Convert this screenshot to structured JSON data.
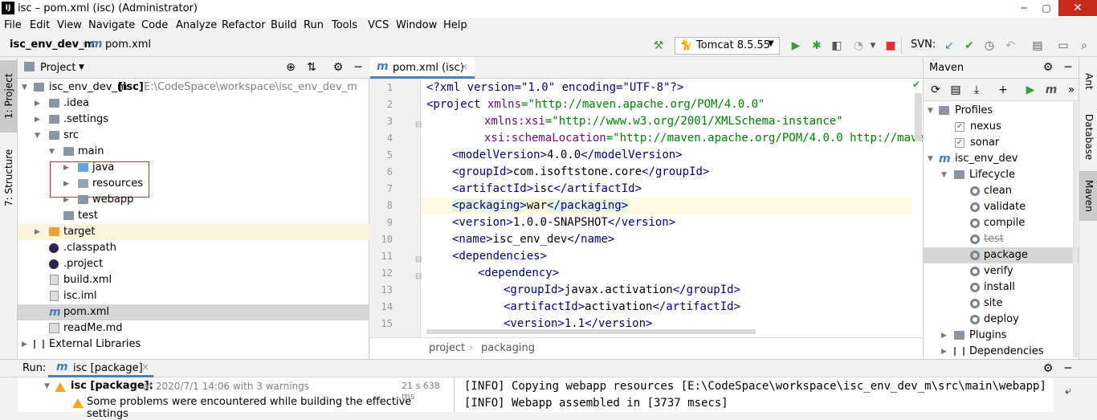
{
  "window": {
    "title": "isc – pom.xml (isc) (Administrator)",
    "logo": "IJ",
    "minimize": "─",
    "maximize": "▢",
    "close": "✕"
  },
  "menu": [
    "File",
    "Edit",
    "View",
    "Navigate",
    "Code",
    "Analyze",
    "Refactor",
    "Build",
    "Run",
    "Tools",
    "VCS",
    "Window",
    "Help"
  ],
  "nav": {
    "project": "isc_env_dev_m",
    "file": "pom.xml",
    "run_config": "Tomcat 8.5.55",
    "svn_label": "SVN:"
  },
  "left_stripe": {
    "project_tab": "1: Project",
    "structure_tab": "7: Structure"
  },
  "project_panel": {
    "title": "Project",
    "tree": [
      {
        "label": "isc_env_dev_m",
        "bold_suffix": "[isc]",
        "path": "E:\\CodeSpace\\workspace\\isc_env_dev_m"
      },
      {
        "label": ".idea"
      },
      {
        "label": ".settings"
      },
      {
        "label": "src"
      },
      {
        "label": "main"
      },
      {
        "label": "java"
      },
      {
        "label": "resources"
      },
      {
        "label": "webapp"
      },
      {
        "label": "test"
      },
      {
        "label": "target"
      },
      {
        "label": ".classpath"
      },
      {
        "label": ".project"
      },
      {
        "label": "build.xml"
      },
      {
        "label": "isc.iml"
      },
      {
        "label": "pom.xml"
      },
      {
        "label": "readMe.md"
      },
      {
        "label": "External Libraries"
      }
    ]
  },
  "editor": {
    "tab_label": "pom.xml (isc)",
    "line_numbers": [
      "1",
      "2",
      "3",
      "4",
      "5",
      "6",
      "7",
      "8",
      "9",
      "10",
      "11",
      "12",
      "13",
      "14",
      "15"
    ],
    "breadcrumbs": [
      "project",
      "packaging"
    ],
    "code": {
      "l1": "<?xml version=\"1.0\" encoding=\"UTF-8\"?>",
      "l2_tag": "<project ",
      "l2_attr": "xmlns",
      "l2_val": "=\"http://maven.apache.org/POM/4.0.0\"",
      "l3_attr": "xmlns:xsi",
      "l3_val": "=\"http://www.w3.org/2001/XMLSchema-instance\"",
      "l4_attr": "xsi:schemaLocation",
      "l4_val": "=\"http://maven.apache.org/POM/4.0.0 http://maven.ap",
      "l5_open": "<modelVersion>",
      "l5_text": "4.0.0",
      "l5_close": "</modelVersion>",
      "l6_open": "<groupId>",
      "l6_text": "com.isoftstone.core",
      "l6_close": "</groupId>",
      "l7_open": "<artifactId>",
      "l7_text": "isc",
      "l7_close": "</artifactId>",
      "l8_open": "<packaging>",
      "l8_text": "war",
      "l8_close": "</packaging>",
      "l9_open": "<version>",
      "l9_text": "1.0.0-SNAPSHOT",
      "l9_close": "</version>",
      "l10_open": "<name>",
      "l10_text": "isc_env_dev",
      "l10_close": "</name>",
      "l11": "<dependencies>",
      "l12": "<dependency>",
      "l13_open": "<groupId>",
      "l13_text": "javax.activation",
      "l13_close": "</groupId>",
      "l14_open": "<artifactId>",
      "l14_text": "activation",
      "l14_close": "</artifactId>",
      "l15_open": "<version>",
      "l15_text": "1.1",
      "l15_close": "</version>"
    }
  },
  "maven_panel": {
    "title": "Maven",
    "profiles_label": "Profiles",
    "profiles": [
      "nexus",
      "sonar"
    ],
    "project": "isc_env_dev",
    "lifecycle_label": "Lifecycle",
    "lifecycle": [
      "clean",
      "validate",
      "compile",
      "test",
      "package",
      "verify",
      "install",
      "site",
      "deploy"
    ],
    "plugins_label": "Plugins",
    "dependencies_label": "Dependencies"
  },
  "right_stripe": {
    "ant": "Ant",
    "database": "Database",
    "maven": "Maven"
  },
  "run_panel": {
    "label": "Run:",
    "tab": "isc [package]",
    "task_name": "isc [package]:",
    "task_detail": "at 2020/7/1 14:06 with 3 warnings",
    "duration": "21 s 638 ms",
    "warning_msg": "Some problems were encountered while building the effective settings",
    "console": [
      "[INFO] Copying webapp resources [E:\\CodeSpace\\workspace\\isc_env_dev_m\\src\\main\\webapp]",
      "[INFO] Webapp assembled in [3737 msecs]"
    ]
  },
  "colors": {
    "accent": "#4083c9",
    "run_green": "#3a9c3a",
    "stop_red": "#d9372d",
    "highlight_box": "#c0392b",
    "warning": "#e9a92e"
  }
}
